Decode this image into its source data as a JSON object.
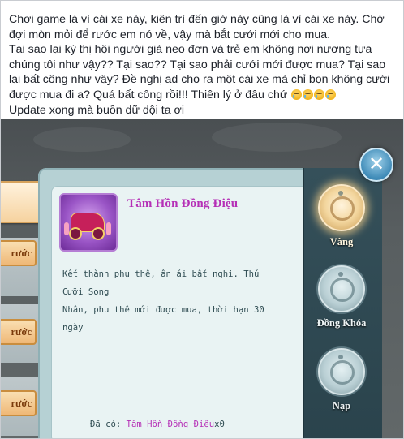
{
  "post": {
    "lines": [
      "Chơi game là vì cái xe này, kiên trì đến giờ này cũng là vì cái xe này. Chờ",
      "đợi mòn mỏi để rước em nó về, vậy mà bắt cưới mới cho mua.",
      "Tại sao lại kỳ thị hội người già neo đơn và trẻ em không nơi nương tựa",
      "chúng tôi như vậy?? Tại sao?? Tại sao phải cưới mới được mua? Tại sao",
      "lại bất công như vậy? Đề nghị ad cho ra một cái xe mà chỉ bọn không cưới",
      "được mua đi a? Quá bất công rồi!!! Thiên lý ở đâu chứ",
      "Update xong mà buồn dữ dội ta ơi"
    ],
    "emoji_name": "sad-tear-face-icon",
    "emoji_count": 4
  },
  "game": {
    "left_buttons": [
      "rước",
      "rước",
      "rước"
    ],
    "item": {
      "name": "Tâm Hồn Đồng Điệu",
      "icon": "wedding-carriage-icon",
      "description": [
        "Kết thành phu thê, ân ái bất nghi. Thú Cưỡi Song",
        "Nhân, phu thê mới được mua, thời hạn 30 ngày"
      ],
      "owned_label": "Đã có: ",
      "owned_name": "Tâm Hồn Đồng Điệu",
      "owned_count": "x0"
    },
    "currency_tabs": [
      {
        "label": "Vàng",
        "active": true
      },
      {
        "label": "Đồng Khóa",
        "active": false
      },
      {
        "label": "Nạp",
        "active": false
      }
    ],
    "close_symbol": "✕"
  },
  "colors": {
    "title_purple": "#b52fb6",
    "panel_bg": "#b6d1d4",
    "sidebar_bg": "#2a434c",
    "button_orange": "#efb877"
  }
}
